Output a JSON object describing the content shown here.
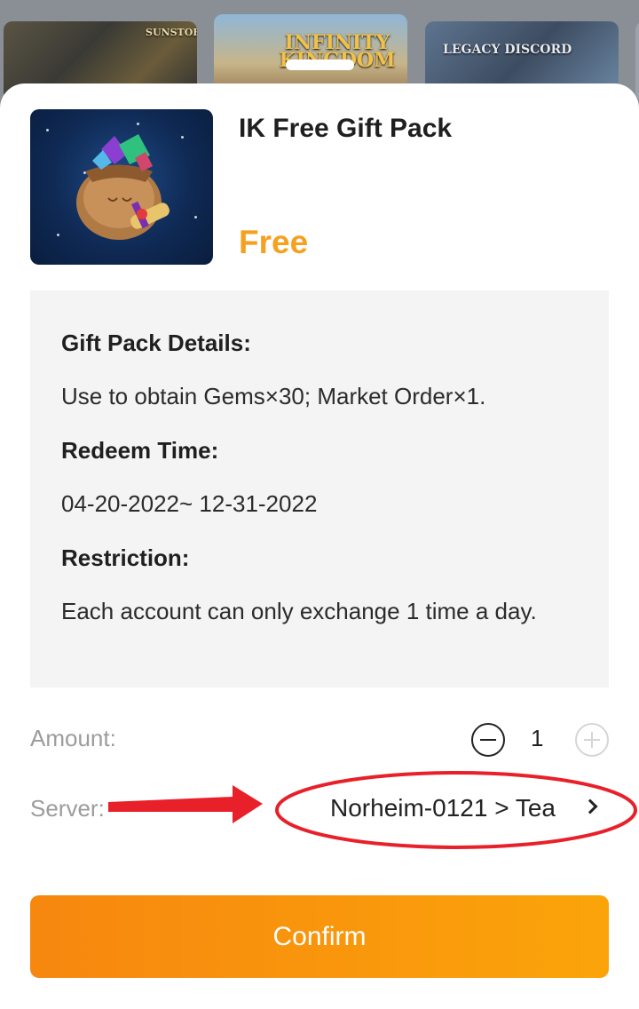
{
  "carousel": {
    "banners": [
      {
        "title": "SUNSTORM"
      },
      {
        "title": "INFINITY KINGDOM"
      },
      {
        "title": "LEGACY DISCORD"
      }
    ]
  },
  "gift": {
    "title": "IK Free Gift Pack",
    "price": "Free",
    "price_color": "#f5a01f"
  },
  "details": {
    "heading_details": "Gift Pack Details:",
    "details_text": "Use to obtain Gems×30; Market Order×1.",
    "heading_redeem": "Redeem Time:",
    "redeem_text": "04-20-2022~ 12-31-2022",
    "heading_restriction": "Restriction:",
    "restriction_text": "Each account can only exchange 1 time a day."
  },
  "amount": {
    "label": "Amount:",
    "value": "1"
  },
  "server": {
    "label": "Server:",
    "value": "Norheim-0121 > Tea"
  },
  "confirm": {
    "label": "Confirm"
  },
  "colors": {
    "accent": "#f7870f",
    "annotation": "#e8202a"
  }
}
